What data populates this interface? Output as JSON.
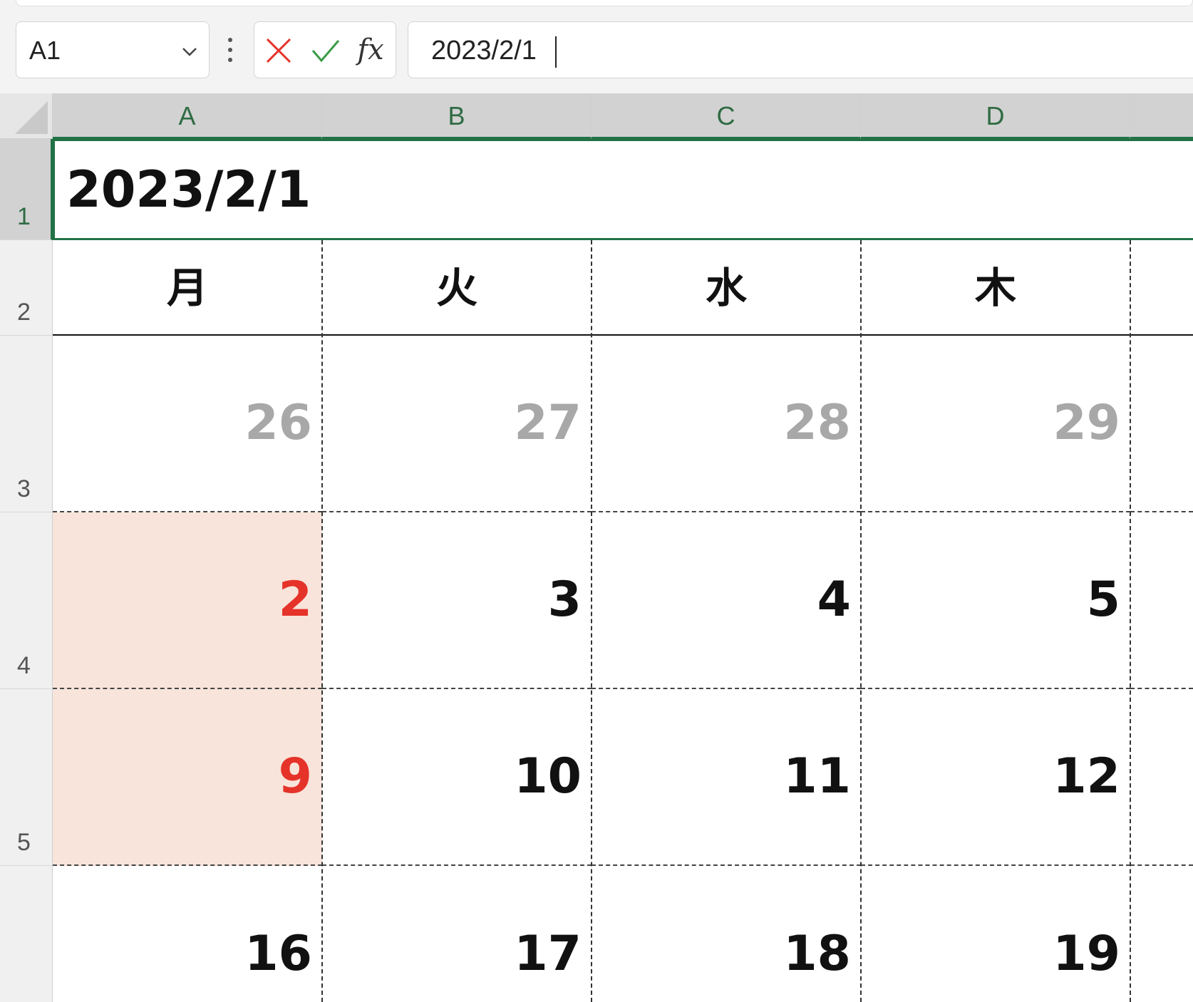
{
  "name_box": {
    "value": "A1"
  },
  "formula_bar": {
    "fx_label": "fx",
    "value": "2023/2/1"
  },
  "columns": [
    "A",
    "B",
    "C",
    "D"
  ],
  "rows": [
    "1",
    "2",
    "3",
    "4",
    "5"
  ],
  "calendar": {
    "title": "2023/2/1",
    "weekdays": [
      "月",
      "火",
      "水",
      "木"
    ],
    "weeks": [
      [
        "26",
        "27",
        "28",
        "29"
      ],
      [
        "2",
        "3",
        "4",
        "5"
      ],
      [
        "9",
        "10",
        "11",
        "12"
      ],
      [
        "16",
        "17",
        "18",
        "19"
      ]
    ]
  },
  "colors": {
    "accent": "#217346",
    "holiday_text": "#e5332a",
    "holiday_fill": "#f8e4da",
    "prev_month_text": "#a8a8a8"
  }
}
